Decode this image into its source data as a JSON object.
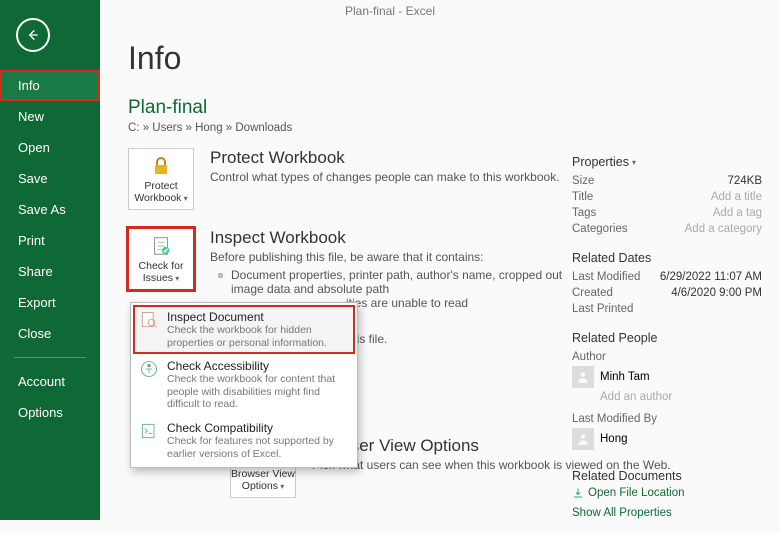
{
  "titlebar": "Plan-final - Excel",
  "sidebar": {
    "items": [
      "Info",
      "New",
      "Open",
      "Save",
      "Save As",
      "Print",
      "Share",
      "Export",
      "Close"
    ],
    "bottom": [
      "Account",
      "Options"
    ],
    "selected_index": 0
  },
  "page": {
    "heading": "Info",
    "file_title": "Plan-final",
    "breadcrumb": "C: » Users » Hong » Downloads"
  },
  "protect": {
    "button": "Protect Workbook",
    "heading": "Protect Workbook",
    "desc": "Control what types of changes people can make to this workbook."
  },
  "inspect": {
    "button": "Check for Issues",
    "heading": "Inspect Workbook",
    "desc": "Before publishing this file, be aware that it contains:",
    "bullets": [
      "Document properties, printer path, author's name, cropped out image data and absolute path",
      "ities are unable to read"
    ],
    "menu": [
      {
        "title": "Inspect Document",
        "sub": "Check the workbook for hidden properties or personal information."
      },
      {
        "title": "Check Accessibility",
        "sub": "Check the workbook for content that people with disabilities might find difficult to read."
      },
      {
        "title": "Check Compatibility",
        "sub": "Check for features not supported by earlier versions of Excel."
      }
    ],
    "trailing": "f this file."
  },
  "browser": {
    "button": "Browser View Options",
    "heading": "Browser View Options",
    "desc": "Pick what users can see when this workbook is viewed on the Web."
  },
  "props": {
    "header": "Properties",
    "rows": [
      {
        "k": "Size",
        "v": "724KB"
      },
      {
        "k": "Title",
        "v": "Add a title",
        "hint": true
      },
      {
        "k": "Tags",
        "v": "Add a tag",
        "hint": true
      },
      {
        "k": "Categories",
        "v": "Add a category",
        "hint": true
      }
    ],
    "dates_header": "Related Dates",
    "dates": [
      {
        "k": "Last Modified",
        "v": "6/29/2022 11:07 AM"
      },
      {
        "k": "Created",
        "v": "4/6/2020 9:00 PM"
      },
      {
        "k": "Last Printed",
        "v": ""
      }
    ],
    "people_header": "Related People",
    "author_label": "Author",
    "author": "Minh Tam",
    "add_author": "Add an author",
    "modified_label": "Last Modified By",
    "modified_by": "Hong",
    "docs_header": "Related Documents",
    "open_loc": "Open File Location",
    "show_all": "Show All Properties"
  }
}
